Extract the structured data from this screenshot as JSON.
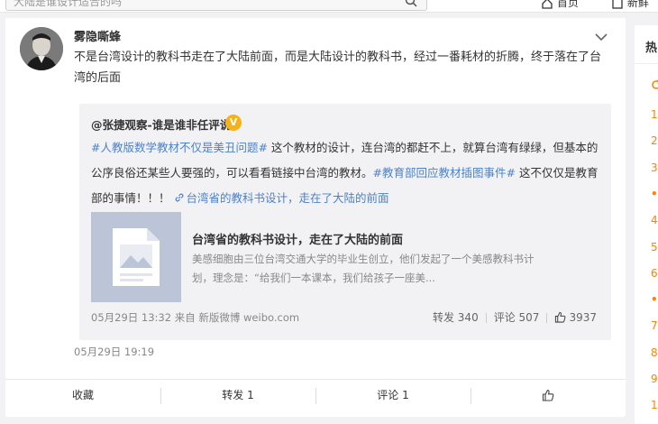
{
  "header": {
    "search_text": "大陆是谁设计适合的吗",
    "nav_home": "首页",
    "nav_new": "新鲜"
  },
  "post": {
    "author": "雾隐嘶蜂",
    "text": "不是台湾设计的教科书走在了大陆前面，而是大陆设计的教科书，经过一番耗材的折腾，终于落在了台湾的后面",
    "time": "05月29日 19:19"
  },
  "repost": {
    "author": "@张捷观察-谁是谁非任评说",
    "badge": "V",
    "hashtag1": "#人教版数学教材不仅是美丑问题#",
    "text1": " 这个教材的设计，连台湾的都赶不上，就算台湾有绿绿，但基本的公序良俗还某些人要强的，可以看看链接中台湾的教材。",
    "hashtag2": "#教育部回应教材插图事件#",
    "text2": " 这不仅仅是教育部的事情！！！",
    "link_label": "台湾省的教科书设计，走在了大陆的前面",
    "card_title": "台湾省的教科书设计，走在了大陆的前面",
    "card_desc": "美感细胞由三位台湾交通大学的毕业生创立，他们发起了一个美感教科书计划，理念是：“给我们一本课本，我们给孩子一座美...",
    "meta": "05月29日 13:32 来自 新版微博 weibo.com",
    "repost_count": "转发 340",
    "comment_count": "评论 507",
    "like_count": "3937"
  },
  "actions": {
    "favorite": "收藏",
    "forward": "转发 1",
    "comment": "评论 1"
  },
  "sidebar": {
    "title": "热",
    "ranks": [
      "1",
      "2",
      "3",
      "•",
      "4",
      "5",
      "6",
      "•",
      "7",
      "8",
      "9",
      "1"
    ]
  },
  "colors": {
    "link": "#4b82c9",
    "rank": "#ff8200",
    "badge": "#f5b21b"
  }
}
